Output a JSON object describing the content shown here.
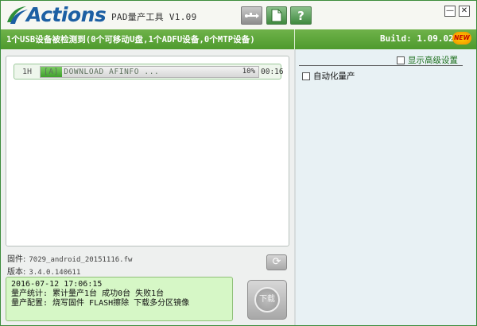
{
  "app": {
    "logo_text": "Actions",
    "subtitle": "PAD量产工具 V1.09",
    "brand_color": "#1c5fa3",
    "accent_color": "#4e9a2d"
  },
  "toolbar": {
    "buttons": [
      {
        "icon": "usb-icon"
      },
      {
        "icon": "document-icon"
      },
      {
        "icon": "help-icon",
        "label": "?"
      }
    ]
  },
  "window_controls": {
    "minimize": "—",
    "close": "✕"
  },
  "status": {
    "summary": "1个USB设备被检测到(0个可移动U盘,1个ADFU设备,0个MTP设备)",
    "build": "Build: 1.09.02",
    "badge": "NEW"
  },
  "devices": [
    {
      "port": "1H",
      "task": "[A] DOWNLOAD AFINFO ...",
      "progress_percent": 10,
      "progress_label": "10%",
      "elapsed": "00:16"
    }
  ],
  "firmware": {
    "label": "固件:",
    "value": "7029_android_20151116.fw"
  },
  "version": {
    "label": "版本:",
    "value": "3.4.0.140611"
  },
  "log": {
    "lines": [
      "2016-07-12 17:06:15",
      "量产统计: 累计量产1台 成功0台 失败1台",
      "量产配置: 烧写固件 FLASH擦除 下载多分区镜像"
    ]
  },
  "start_button": {
    "label": "下载"
  },
  "settings": {
    "advanced_label": "显示高级设置",
    "advanced_checked": false,
    "auto_label": "自动化量产",
    "auto_checked": false
  }
}
